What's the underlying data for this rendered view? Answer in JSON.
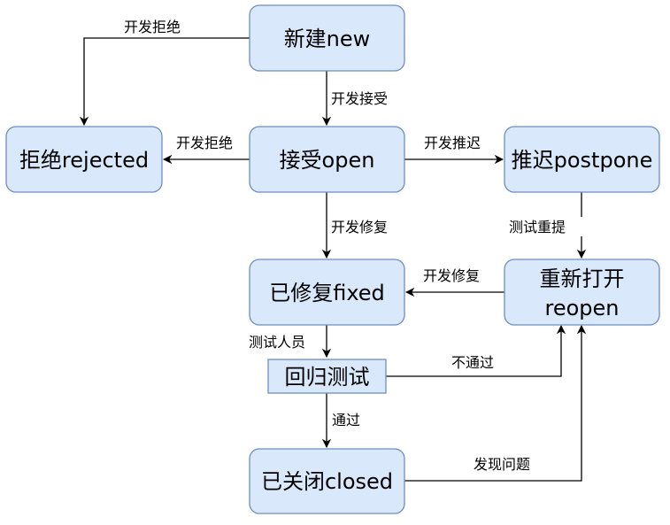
{
  "colors": {
    "node_fill": "#dae8fc",
    "node_stroke": "#6c8ebf",
    "edge": "#000000",
    "background": "#ffffff"
  },
  "nodes": {
    "new": "新建new",
    "open": "接受open",
    "rejected": "拒绝rejected",
    "postpone": "推迟postpone",
    "fixed": "已修复fixed",
    "reopen_line1": "重新打开",
    "reopen_line2": "reopen",
    "regression": "回归测试",
    "closed": "已关闭closed"
  },
  "edges": {
    "new_to_rejected": "开发拒绝",
    "new_to_open": "开发接受",
    "open_to_rejected": "开发拒绝",
    "open_to_postpone": "开发推迟",
    "open_to_fixed": "开发修复",
    "postpone_to_reopen": "测试重提",
    "reopen_to_fixed": "开发修复",
    "fixed_to_regression": "测试人员",
    "regression_to_reopen": "不通过",
    "regression_to_closed": "通过",
    "closed_to_reopen": "发现问题"
  }
}
